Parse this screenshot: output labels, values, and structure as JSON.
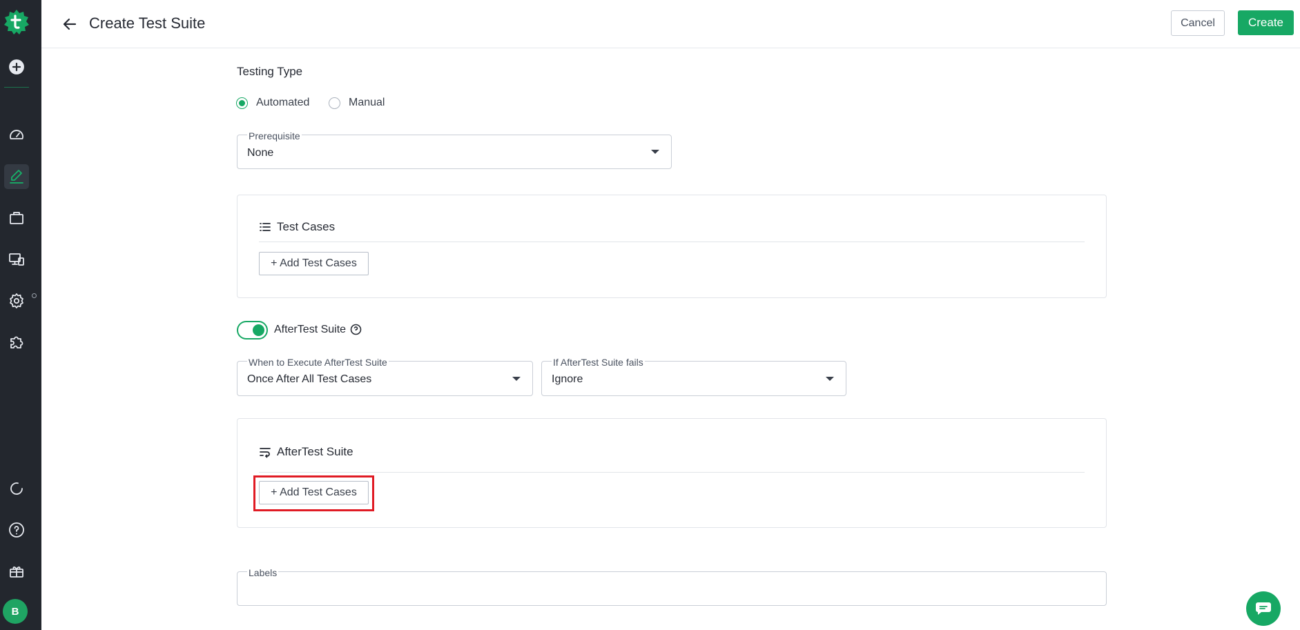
{
  "header": {
    "title": "Create Test Suite",
    "cancel_label": "Cancel",
    "create_label": "Create"
  },
  "sidebar": {
    "avatar_initial": "B",
    "icons": [
      "logo-icon",
      "plus-circle-icon",
      "dashboard-icon",
      "edit-icon",
      "briefcase-icon",
      "devices-icon",
      "gear-icon",
      "puzzle-icon",
      "refresh-icon",
      "help-icon",
      "gift-icon"
    ],
    "active_item": "edit-icon"
  },
  "testing_type": {
    "label": "Testing Type",
    "options": [
      {
        "label": "Automated",
        "checked": true
      },
      {
        "label": "Manual",
        "checked": false
      }
    ]
  },
  "prerequisite": {
    "label": "Prerequisite",
    "value": "None"
  },
  "test_cases_card": {
    "title": "Test Cases",
    "add_label": "+ Add Test Cases"
  },
  "after_test": {
    "toggle_label": "AfterTest Suite",
    "toggle_on": true,
    "when_label": "When to Execute AfterTest Suite",
    "when_value": "Once After All Test Cases",
    "fail_label": "If AfterTest Suite fails",
    "fail_value": "Ignore"
  },
  "after_test_card": {
    "title": "AfterTest Suite",
    "add_label": "+ Add Test Cases"
  },
  "labels_field": {
    "label": "Labels"
  },
  "colors": {
    "accent": "#17a864",
    "sidebar": "#23272e",
    "highlight": "#e01b24"
  }
}
